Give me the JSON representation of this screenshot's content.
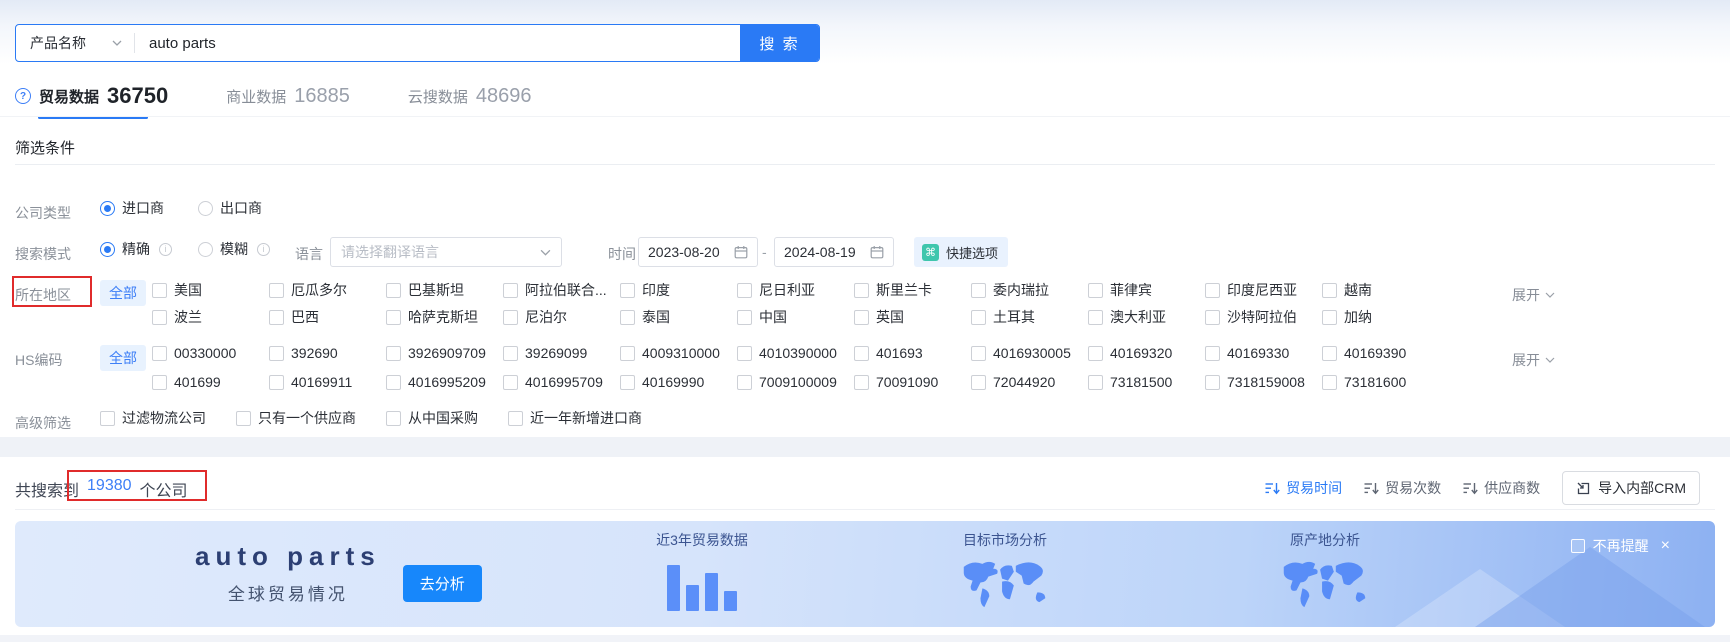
{
  "search": {
    "category_label": "产品名称",
    "query": "auto parts",
    "button_label": "搜 索"
  },
  "tabs": [
    {
      "label": "贸易数据",
      "count": "36750",
      "active": true
    },
    {
      "label": "商业数据",
      "count": "16885",
      "active": false
    },
    {
      "label": "云搜数据",
      "count": "48696",
      "active": false
    }
  ],
  "filter": {
    "title": "筛选条件",
    "company_type": {
      "label": "公司类型",
      "options": [
        {
          "label": "进口商",
          "selected": true
        },
        {
          "label": "出口商",
          "selected": false
        }
      ]
    },
    "search_mode": {
      "label": "搜索模式",
      "options": [
        {
          "label": "精确",
          "selected": true
        },
        {
          "label": "模糊",
          "selected": false
        }
      ]
    },
    "language": {
      "label": "语言",
      "placeholder": "请选择翻译语言"
    },
    "time": {
      "label": "时间",
      "start": "2023-08-20",
      "separator": "-",
      "end": "2024-08-19"
    },
    "quick_option_label": "快捷选项",
    "region": {
      "label": "所在地区",
      "all_label": "全部",
      "expand_label": "展开",
      "row1": [
        "美国",
        "厄瓜多尔",
        "巴基斯坦",
        "阿拉伯联合...",
        "印度",
        "尼日利亚",
        "斯里兰卡",
        "委内瑞拉",
        "菲律宾",
        "印度尼西亚",
        "越南"
      ],
      "row2": [
        "波兰",
        "巴西",
        "哈萨克斯坦",
        "尼泊尔",
        "泰国",
        "中国",
        "英国",
        "土耳其",
        "澳大利亚",
        "沙特阿拉伯",
        "加纳"
      ]
    },
    "hs_code": {
      "label": "HS编码",
      "all_label": "全部",
      "expand_label": "展开",
      "row1": [
        "00330000",
        "392690",
        "3926909709",
        "39269099",
        "4009310000",
        "4010390000",
        "401693",
        "4016930005",
        "40169320",
        "40169330",
        "40169390"
      ],
      "row2": [
        "401699",
        "40169911",
        "4016995209",
        "4016995709",
        "40169990",
        "7009100009",
        "70091090",
        "72044920",
        "73181500",
        "7318159008",
        "73181600"
      ]
    },
    "advanced": {
      "label": "高级筛选",
      "options": [
        "过滤物流公司",
        "只有一个供应商",
        "从中国采购",
        "近一年新增进口商"
      ]
    }
  },
  "results": {
    "summary_prefix": "共搜索到",
    "summary_count": "19380",
    "summary_suffix": "个公司",
    "sorts": [
      {
        "label": "贸易时间",
        "active": true
      },
      {
        "label": "贸易次数",
        "active": false
      },
      {
        "label": "供应商数",
        "active": false
      }
    ],
    "import_button_label": "导入内部CRM"
  },
  "banner": {
    "keyword": "auto parts",
    "subtitle": "全球贸易情况",
    "analyze_label": "去分析",
    "section_trade": "近3年贸易数据",
    "section_market": "目标市场分析",
    "section_origin": "原产地分析",
    "dismiss_label": "不再提醒",
    "close_label": "×"
  },
  "colors": {
    "primary": "#2a7af5",
    "link_blue": "#3d7ff7",
    "accent_teal": "#3fc6ad",
    "annotation_red": "#e02b2b"
  }
}
